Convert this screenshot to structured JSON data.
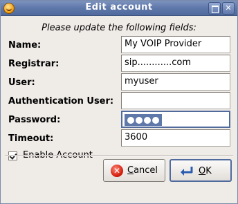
{
  "window": {
    "title": "Edit account",
    "close_glyph": "✕"
  },
  "form": {
    "instructions": "Please update the following fields:",
    "fields": [
      {
        "label": "Name:",
        "value": "My VOIP Provider"
      },
      {
        "label": "Registrar:",
        "value": "sip............com"
      },
      {
        "label": "User:",
        "value": "myuser"
      },
      {
        "label": "Authentication User:",
        "value": ""
      },
      {
        "label": "Password:",
        "value": "●●●●"
      },
      {
        "label": "Timeout:",
        "value": "3600"
      }
    ],
    "enable_account": {
      "label": "Enable Account",
      "checked": true
    }
  },
  "buttons": {
    "cancel": {
      "label": "Cancel",
      "mnemonic": "C",
      "rest": "ancel",
      "icon": "cancel-icon"
    },
    "ok": {
      "label": "OK",
      "mnemonic": "O",
      "rest": "K",
      "icon": "ok-enter-icon"
    }
  }
}
